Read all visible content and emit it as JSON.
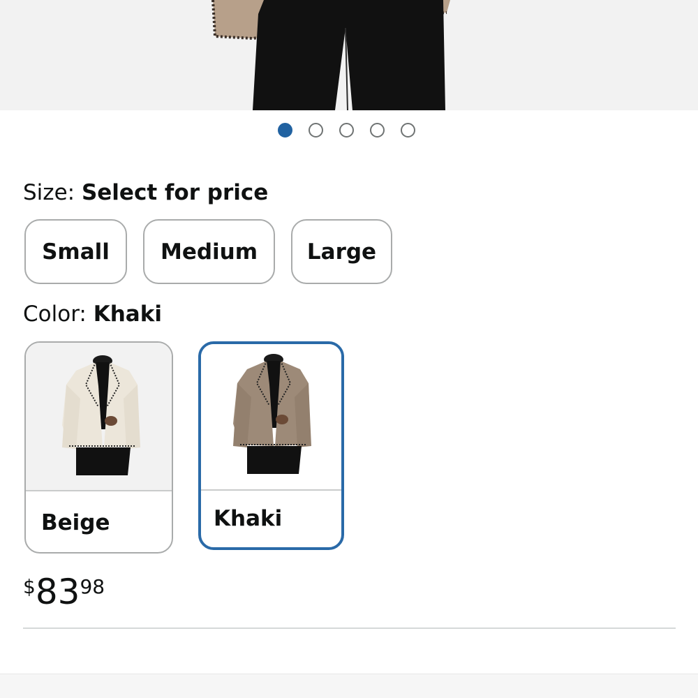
{
  "carousel": {
    "total": 5,
    "active_index": 0
  },
  "size": {
    "label": "Size: ",
    "value": "Select for price",
    "options": [
      "Small",
      "Medium",
      "Large"
    ]
  },
  "color": {
    "label": "Color: ",
    "value": "Khaki",
    "options": [
      {
        "name": "Beige",
        "selected": false
      },
      {
        "name": "Khaki",
        "selected": true
      }
    ]
  },
  "price": {
    "symbol": "$",
    "whole": "83",
    "fraction": "98"
  },
  "colors": {
    "accent": "#2162a1",
    "selected_border": "#2a6aa8",
    "beige_coat": "#ece6da",
    "khaki_coat": "#9d8a78"
  }
}
